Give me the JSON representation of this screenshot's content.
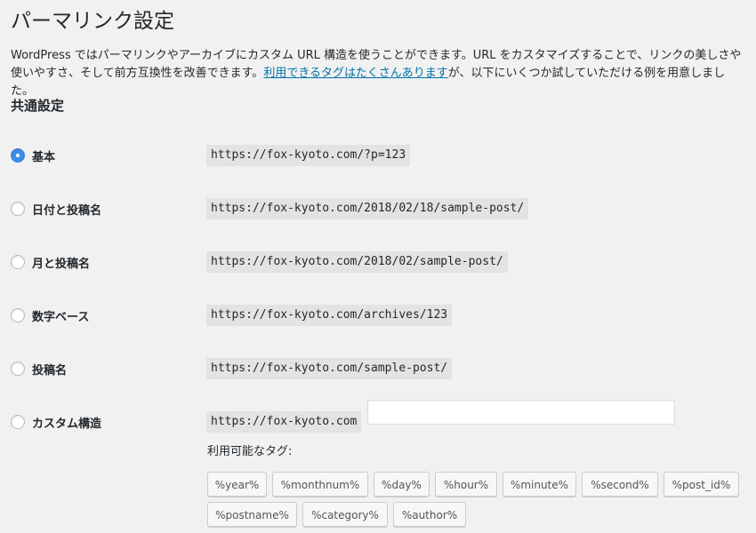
{
  "page": {
    "title": "パーマリンク設定",
    "description_before": "WordPress ではパーマリンクやアーカイブにカスタム URL 構造を使うことができます。URL をカスタマイズすることで、リンクの美しさや使いやすさ、そして前方互換性を改善できます。",
    "description_link": "利用できるタグはたくさんあります",
    "description_after": "が、以下にいくつか試していただける例を用意しました。",
    "section_title": "共通設定"
  },
  "options": [
    {
      "label": "基本",
      "example": "https://fox-kyoto.com/?p=123",
      "checked": true
    },
    {
      "label": "日付と投稿名",
      "example": "https://fox-kyoto.com/2018/02/18/sample-post/",
      "checked": false
    },
    {
      "label": "月と投稿名",
      "example": "https://fox-kyoto.com/2018/02/sample-post/",
      "checked": false
    },
    {
      "label": "数字ベース",
      "example": "https://fox-kyoto.com/archives/123",
      "checked": false
    },
    {
      "label": "投稿名",
      "example": "https://fox-kyoto.com/sample-post/",
      "checked": false
    },
    {
      "label": "カスタム構造",
      "example": "https://fox-kyoto.com",
      "checked": false,
      "value": ""
    }
  ],
  "available_tags": {
    "label": "利用可能なタグ:",
    "tags": [
      "%year%",
      "%monthnum%",
      "%day%",
      "%hour%",
      "%minute%",
      "%second%",
      "%post_id%",
      "%postname%",
      "%category%",
      "%author%"
    ]
  },
  "colors": {
    "link": "#0073aa",
    "radio_checked": "#3e8ee8",
    "background": "#f1f1f1"
  }
}
